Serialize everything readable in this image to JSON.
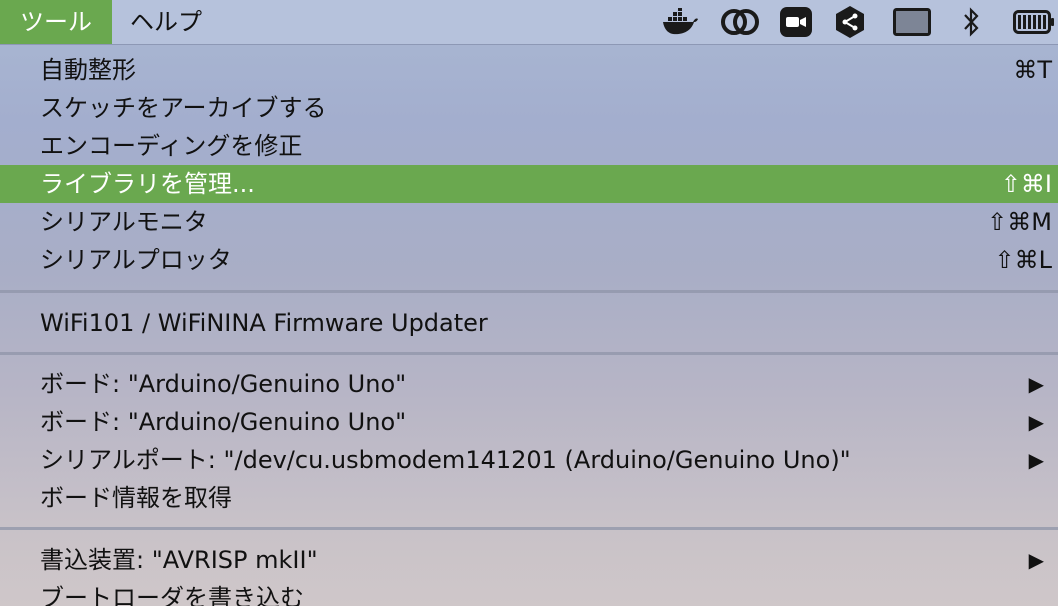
{
  "menubar": {
    "tools_label": "ツール",
    "help_label": "ヘルプ",
    "status_icons": [
      "docker-icon",
      "creative-cloud-icon",
      "zoom-icon",
      "share-app-icon",
      "display-icon",
      "bluetooth-icon",
      "battery-icon"
    ]
  },
  "menu": {
    "auto_format": {
      "label": "自動整形",
      "shortcut": "⌘T"
    },
    "archive_sketch": {
      "label": "スケッチをアーカイブする"
    },
    "fix_encoding": {
      "label": "エンコーディングを修正"
    },
    "manage_libraries": {
      "label": "ライブラリを管理...",
      "shortcut": "⇧⌘I"
    },
    "serial_monitor": {
      "label": "シリアルモニタ",
      "shortcut": "⇧⌘M"
    },
    "serial_plotter": {
      "label": "シリアルプロッタ",
      "shortcut": "⇧⌘L"
    },
    "firmware_updater": {
      "label": "WiFi101 / WiFiNINA Firmware Updater"
    },
    "board_1": {
      "label": "ボード: \"Arduino/Genuino Uno\""
    },
    "board_2": {
      "label": "ボード: \"Arduino/Genuino Uno\""
    },
    "serial_port": {
      "label": "シリアルポート: \"/dev/cu.usbmodem141201 (Arduino/Genuino Uno)\""
    },
    "board_info": {
      "label": "ボード情報を取得"
    },
    "programmer": {
      "label": "書込装置: \"AVRISP mkII\""
    },
    "burn_bootloader": {
      "label": "ブートローダを書き込む"
    },
    "submenu_arrow": "▶"
  },
  "colors": {
    "highlight": "#6aa84f",
    "menubar": "#b6c2dc"
  }
}
